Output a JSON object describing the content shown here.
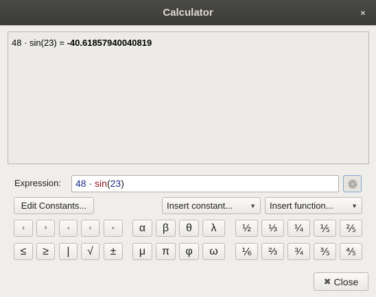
{
  "window": {
    "title": "Calculator",
    "close_glyph": "×"
  },
  "result": {
    "expression": "48 · sin(23) = ",
    "value": "-40.61857940040819"
  },
  "expression": {
    "label": "Expression:",
    "num1": "48",
    "dot": " · ",
    "fn": "sin",
    "paren_open": "(",
    "num2": "23",
    "paren_close": ")"
  },
  "buttons": {
    "edit_constants": "Edit Constants...",
    "insert_constant": "Insert constant...",
    "insert_function": "Insert function...",
    "close": "Close",
    "close_icon": "✖"
  },
  "superscripts": [
    "²",
    "³",
    "⁴",
    "⁵",
    "⁶"
  ],
  "relations": [
    "≤",
    "≥",
    "|",
    "√",
    "±"
  ],
  "greek_row1": [
    "α",
    "β",
    "θ",
    "λ"
  ],
  "greek_row2": [
    "μ",
    "π",
    "φ",
    "ω"
  ],
  "fractions_row1": [
    "½",
    "⅓",
    "¼",
    "⅕",
    "⅖"
  ],
  "fractions_row2": [
    "⅙",
    "⅔",
    "¾",
    "⅗",
    "⅘"
  ]
}
